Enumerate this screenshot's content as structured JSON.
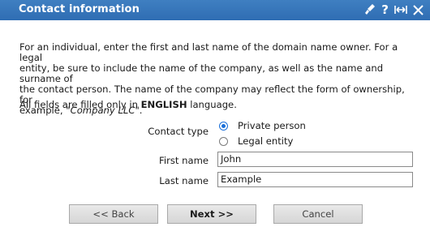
{
  "dialog": {
    "title": "Contact information",
    "intro_line1": "For an individual, enter the first and last name of the domain name owner. For a legal",
    "intro_line2": "entity, be sure to include the name of the company, as well as the name and surname of",
    "intro_line3": "the contact person. The name of the company may reflect the form of ownership, for",
    "intro_line4_prefix": "example, \"",
    "intro_line4_italic": "Company LLC",
    "intro_line4_suffix": "\".",
    "lang_prefix": "All fields are filled only in ",
    "lang_bold": "ENGLISH",
    "lang_suffix": " language."
  },
  "form": {
    "contact_type_label": "Contact type",
    "option_private": "Private person",
    "option_legal": "Legal entity",
    "selected_option": "Private person",
    "first_name_label": "First name",
    "first_name_value": "John",
    "last_name_label": "Last name",
    "last_name_value": "Example"
  },
  "buttons": {
    "back": "<< Back",
    "next": "Next >>",
    "cancel": "Cancel"
  },
  "titlebar_icons": [
    "brush-icon",
    "help-icon",
    "expand-icon",
    "close-icon"
  ],
  "colors": {
    "titlebar": "#3a78bd",
    "radio_selected": "#1a6fd9"
  }
}
